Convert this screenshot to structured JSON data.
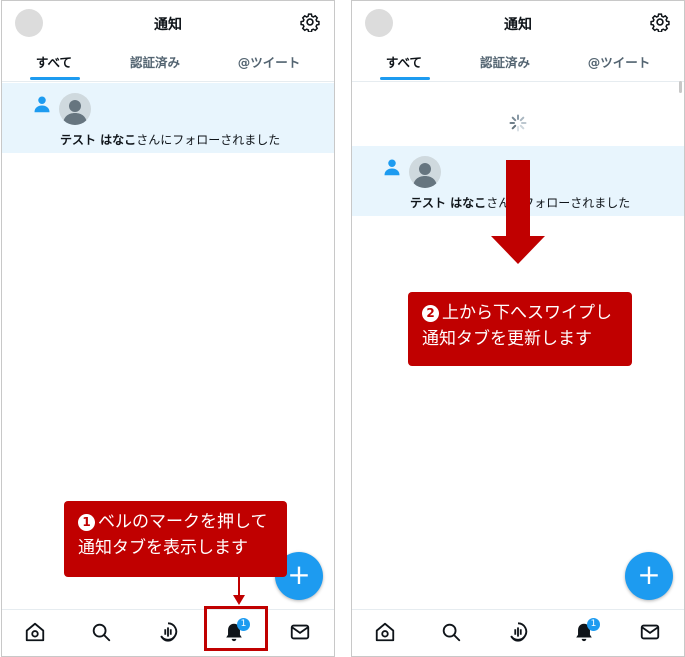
{
  "header": {
    "title": "通知"
  },
  "tabs": [
    {
      "label": "すべて"
    },
    {
      "label": "認証済み"
    },
    {
      "label": "@ツイート"
    }
  ],
  "notification": {
    "user_name": "テスト はなこ",
    "message": "さんにフォローされました"
  },
  "nav": {
    "items": [
      "home-icon",
      "search-icon",
      "spaces-icon",
      "bell-icon",
      "mail-icon"
    ],
    "bell_badge": "1"
  },
  "fab": {
    "label": "+"
  },
  "callouts": {
    "step1": {
      "number": "1",
      "line1": "ベルのマークを押して",
      "line2": "通知タブを表示します"
    },
    "step2": {
      "number": "2",
      "line1": "上から下へスワイプし",
      "line2": "通知タブを更新します"
    }
  },
  "colors": {
    "accent": "#1d9bf0",
    "highlight_bg": "#e8f5fd",
    "callout": "#c00000"
  }
}
